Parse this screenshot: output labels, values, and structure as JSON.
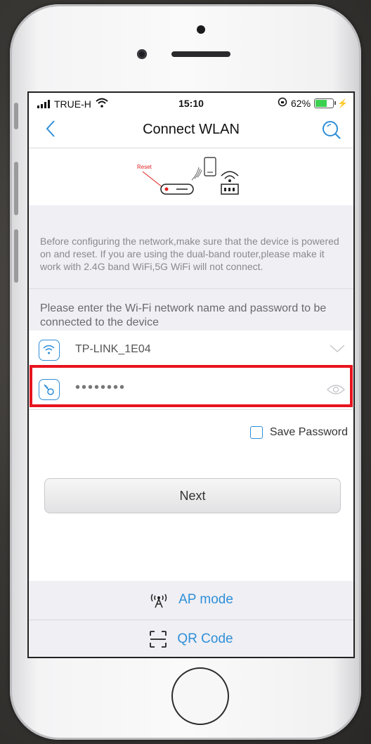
{
  "status_bar": {
    "carrier": "TRUE-H",
    "time": "15:10",
    "battery": "62%"
  },
  "nav": {
    "title": "Connect WLAN",
    "back_icon": "chevron-left-icon",
    "search_icon": "search-icon"
  },
  "illustration": {
    "reset_label": "Reset"
  },
  "info_text": "Before configuring the network,make sure that the device is powered on and reset. If you are using the dual-band router,please make it work with 2.4G band WiFi,5G WiFi will not connect.",
  "enter_hint": "Please enter the Wi-Fi network name and password to be connected to the device",
  "wifi_field": {
    "value": "TP-LINK_1E04",
    "icon": "wifi-icon",
    "dropdown_icon": "chevron-down-icon"
  },
  "password_field": {
    "value": "••••••••",
    "icon": "key-icon",
    "toggle_icon": "eye-icon"
  },
  "save_password": {
    "label": "Save Password",
    "checked": false
  },
  "next_button": {
    "label": "Next"
  },
  "footer": {
    "ap_mode": {
      "label": "AP mode",
      "icon": "antenna-icon"
    },
    "qr_code": {
      "label": "QR Code",
      "icon": "qr-scan-icon"
    }
  },
  "colors": {
    "accent": "#2f8fd8",
    "highlight": "#e8141e",
    "background": "#efeff4"
  }
}
